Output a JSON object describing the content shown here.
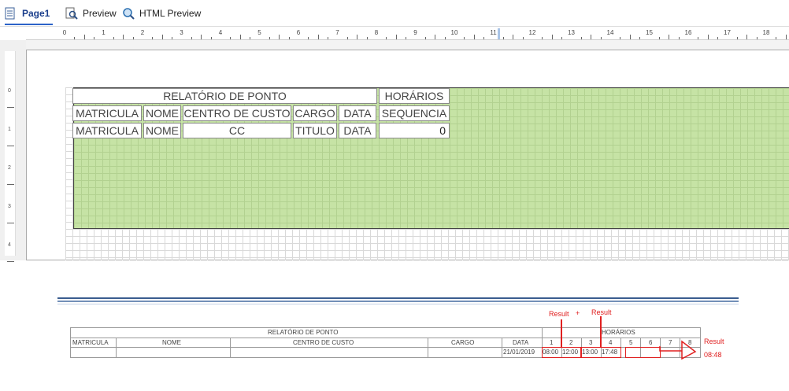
{
  "tabs": {
    "page1": "Page1",
    "preview": "Preview",
    "html_preview": "HTML Preview"
  },
  "ruler": {
    "h_numbers": [
      "0",
      "1",
      "2",
      "3",
      "4",
      "5",
      "6",
      "7",
      "8",
      "9",
      "10",
      "11",
      "12",
      "13",
      "14",
      "15",
      "16",
      "17",
      "18"
    ],
    "v_numbers": [
      "0",
      "1",
      "2",
      "3",
      "4"
    ]
  },
  "designer": {
    "title": "RELATÓRIO DE PONTO",
    "horarios": "HORÁRIOS",
    "headers": [
      "MATRICULA",
      "NOME",
      "CENTRO DE CUSTO",
      "CARGO",
      "DATA"
    ],
    "sequencia": "SEQUENCIA",
    "fields": [
      "MATRICULA",
      "NOME",
      "CC",
      "TITULO",
      "DATA"
    ],
    "sequence_value": "0"
  },
  "preview": {
    "title": "RELATÓRIO DE PONTO",
    "horarios": "HORÁRIOS",
    "headers": [
      "MATRICULA",
      "NOME",
      "CENTRO DE CUSTO",
      "CARGO",
      "DATA"
    ],
    "slots": [
      "1",
      "2",
      "3",
      "4",
      "5",
      "6",
      "7",
      "8"
    ],
    "date": "21/01/2019",
    "times": [
      "08:00",
      "12:00",
      "13:00",
      "17:48"
    ]
  },
  "annotations": {
    "result_plus": "Result",
    "plus": "+",
    "result_mid": "Result",
    "result_right": "Result",
    "result_value": "08:48",
    "colors": {
      "annotation": "#e02020",
      "band": "#c6e3a5"
    }
  }
}
